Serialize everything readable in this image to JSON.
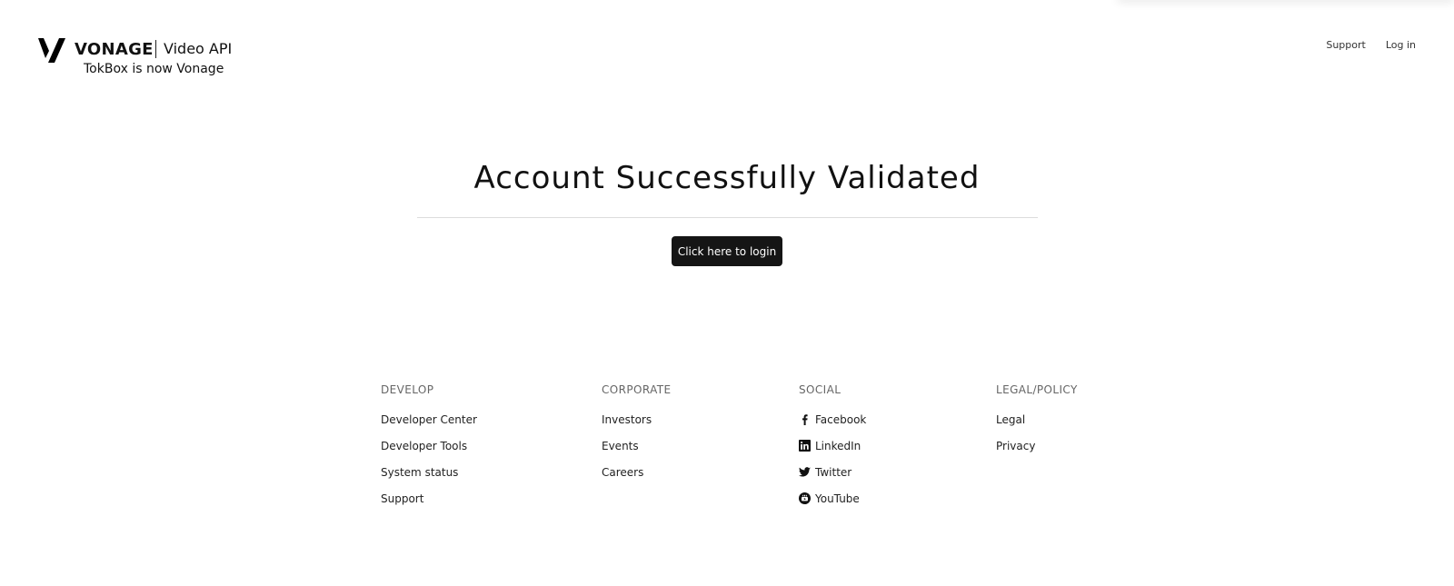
{
  "header": {
    "brand_name": "VONAGE",
    "product_name": "Video API",
    "tagline": "TokBox is now Vonage",
    "nav": [
      {
        "label": "Support",
        "icon": ""
      },
      {
        "label": "Log in",
        "icon": ""
      }
    ]
  },
  "main": {
    "headline": "Account Successfully Validated",
    "login_button": "Click here to login"
  },
  "footer": {
    "columns": [
      {
        "heading": "DEVELOP",
        "links": [
          "Developer Center",
          "Developer Tools",
          "System status",
          "Support"
        ]
      },
      {
        "heading": "CORPORATE",
        "links": [
          "Investors",
          "Events",
          "Careers"
        ]
      },
      {
        "heading": "SOCIAL",
        "links": [
          {
            "label": "Facebook",
            "icon": "facebook-icon"
          },
          {
            "label": "LinkedIn",
            "icon": "linkedin-icon"
          },
          {
            "label": "Twitter",
            "icon": "twitter-icon"
          },
          {
            "label": "YouTube",
            "icon": "youtube-icon"
          }
        ]
      },
      {
        "heading": "LEGAL/POLICY",
        "links": [
          "Legal",
          "Privacy"
        ]
      }
    ]
  },
  "colors": {
    "background": "#ffffff",
    "text": "#111111",
    "button_bg": "#151515",
    "button_text": "#ffffff",
    "divider": "#dcdcdc",
    "footer_heading": "#666666"
  }
}
